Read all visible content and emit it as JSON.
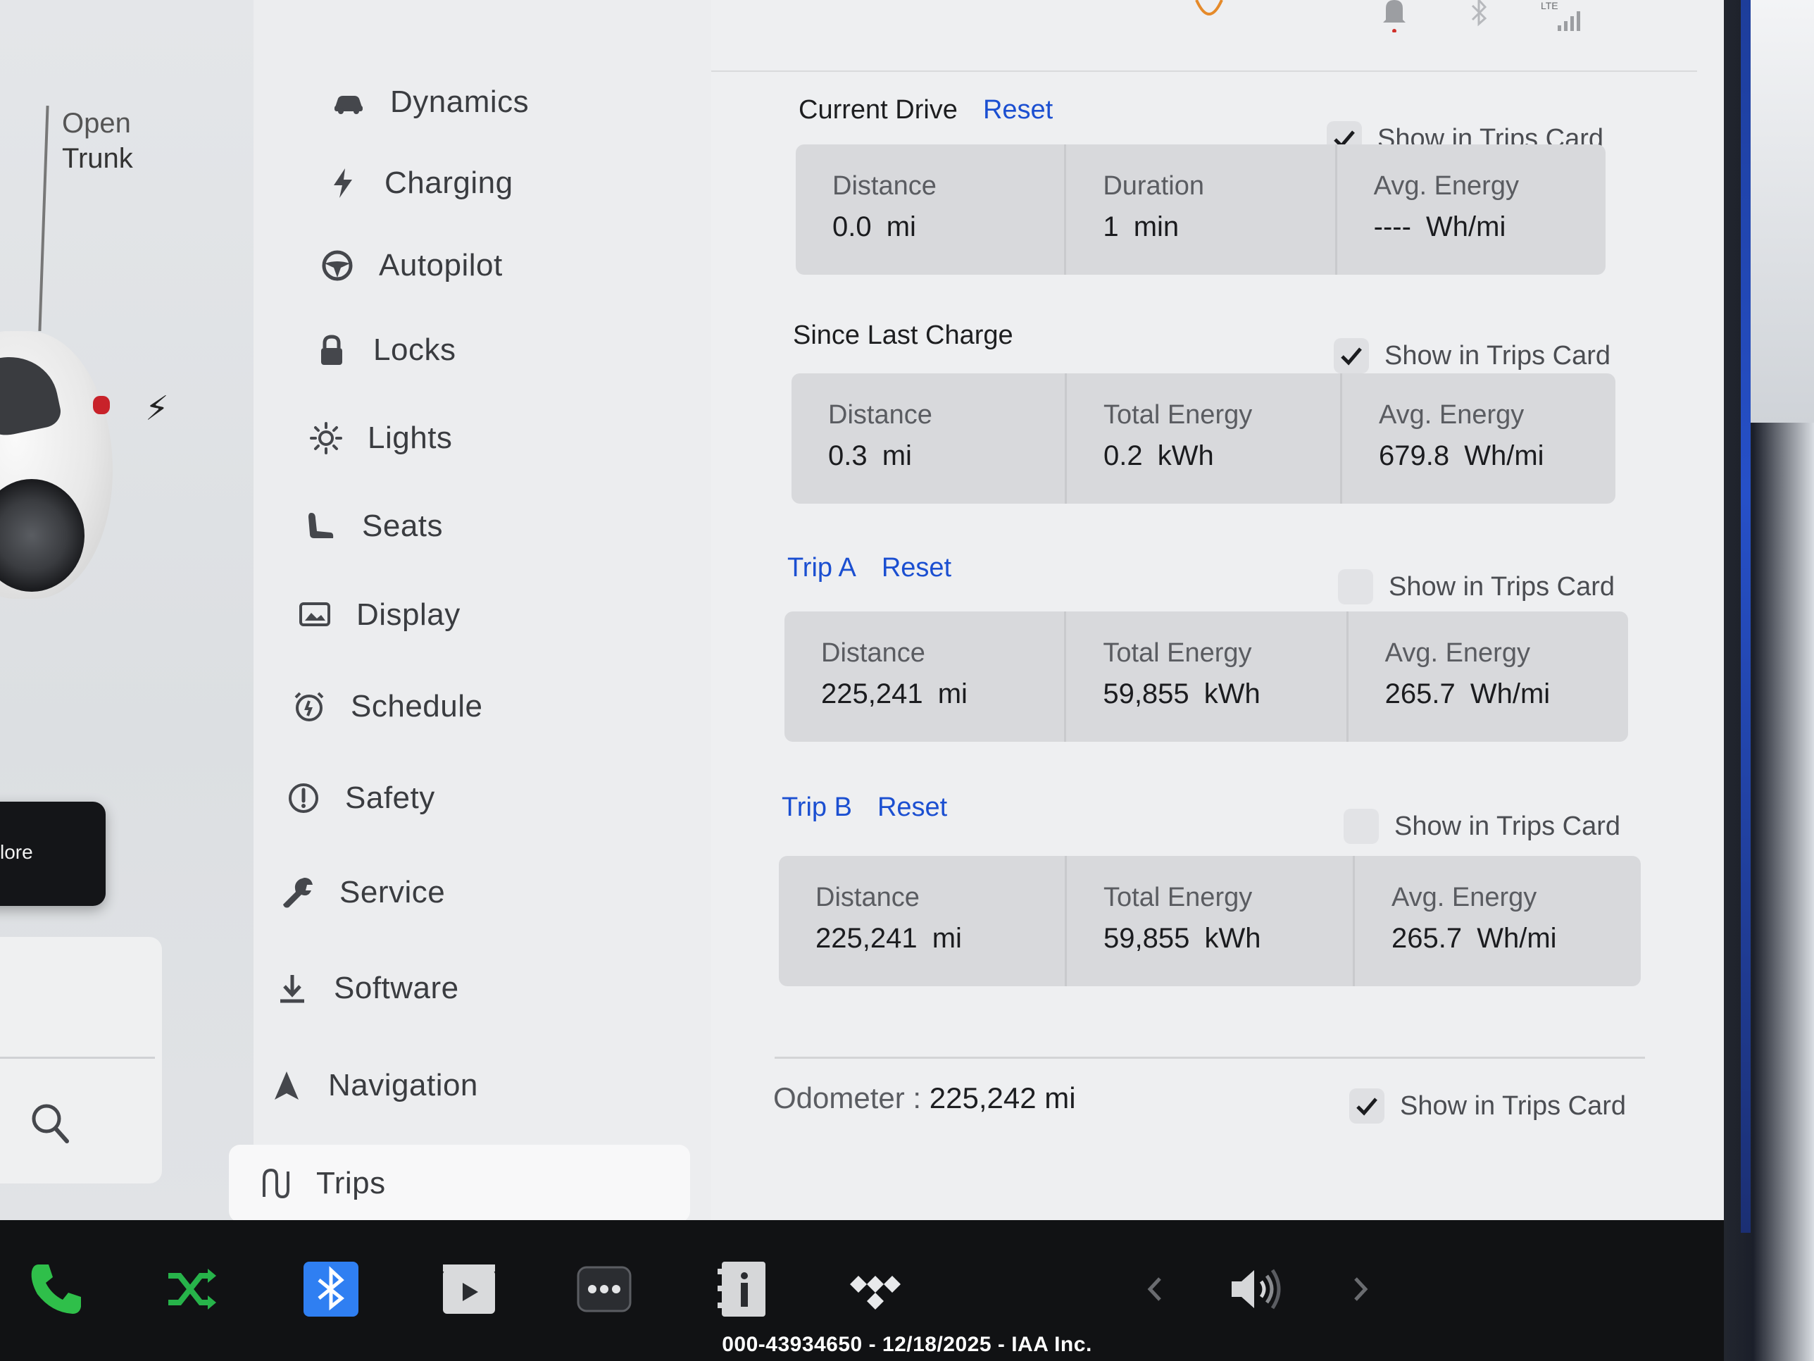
{
  "left": {
    "trunk_label": [
      "Open",
      "Trunk"
    ],
    "explore_label": "lore"
  },
  "nav": {
    "items": [
      {
        "label": "Dynamics",
        "icon": "car-icon"
      },
      {
        "label": "Charging",
        "icon": "bolt-icon"
      },
      {
        "label": "Autopilot",
        "icon": "steering-wheel-icon"
      },
      {
        "label": "Locks",
        "icon": "lock-icon"
      },
      {
        "label": "Lights",
        "icon": "sun-icon"
      },
      {
        "label": "Seats",
        "icon": "seat-icon"
      },
      {
        "label": "Display",
        "icon": "display-icon"
      },
      {
        "label": "Schedule",
        "icon": "alarm-clock-icon"
      },
      {
        "label": "Safety",
        "icon": "alert-circle-icon"
      },
      {
        "label": "Service",
        "icon": "wrench-icon"
      },
      {
        "label": "Software",
        "icon": "download-icon"
      },
      {
        "label": "Navigation",
        "icon": "navigation-arrow-icon"
      },
      {
        "label": "Trips",
        "icon": "trips-icon"
      }
    ],
    "active": "Trips"
  },
  "status": {
    "lte_label": "LTE"
  },
  "current_drive": {
    "title": "Current Drive",
    "reset": "Reset",
    "show_in_trips": "Show in Trips Card",
    "show_checked": true,
    "cells": [
      {
        "label": "Distance",
        "value": "0.0 mi"
      },
      {
        "label": "Duration",
        "value": "1 min"
      },
      {
        "label": "Avg. Energy",
        "value": "---- Wh/mi"
      }
    ]
  },
  "since_last_charge": {
    "title": "Since Last Charge",
    "show_in_trips": "Show in Trips Card",
    "show_checked": true,
    "cells": [
      {
        "label": "Distance",
        "value": "0.3 mi"
      },
      {
        "label": "Total Energy",
        "value": "0.2 kWh"
      },
      {
        "label": "Avg. Energy",
        "value": "679.8 Wh/mi"
      }
    ]
  },
  "trip_a": {
    "title": "Trip A",
    "reset": "Reset",
    "show_in_trips": "Show in Trips Card",
    "show_checked": false,
    "cells": [
      {
        "label": "Distance",
        "value": "225,241 mi"
      },
      {
        "label": "Total Energy",
        "value": "59,855 kWh"
      },
      {
        "label": "Avg. Energy",
        "value": "265.7 Wh/mi"
      }
    ]
  },
  "trip_b": {
    "title": "Trip B",
    "reset": "Reset",
    "show_in_trips": "Show in Trips Card",
    "show_checked": false,
    "cells": [
      {
        "label": "Distance",
        "value": "225,241 mi"
      },
      {
        "label": "Total Energy",
        "value": "59,855 kWh"
      },
      {
        "label": "Avg. Energy",
        "value": "265.7 Wh/mi"
      }
    ]
  },
  "odometer": {
    "label": "Odometer :",
    "value": "225,242 mi",
    "show_in_trips": "Show in Trips Card",
    "show_checked": true
  },
  "taskbar": {
    "icons": [
      "phone-icon",
      "shuffle-icon",
      "bluetooth-icon",
      "media-player-icon",
      "more-dots-icon",
      "manual-icon",
      "tidal-icon",
      "chevron-left-icon",
      "volume-icon",
      "chevron-right-icon"
    ]
  },
  "watermark": "000-43934650 - 12/18/2025 - IAA Inc.",
  "colors": {
    "accent_blue": "#1b4fd1",
    "phone_green": "#2fbf4a",
    "bluetooth_blue": "#2f7ff2"
  }
}
